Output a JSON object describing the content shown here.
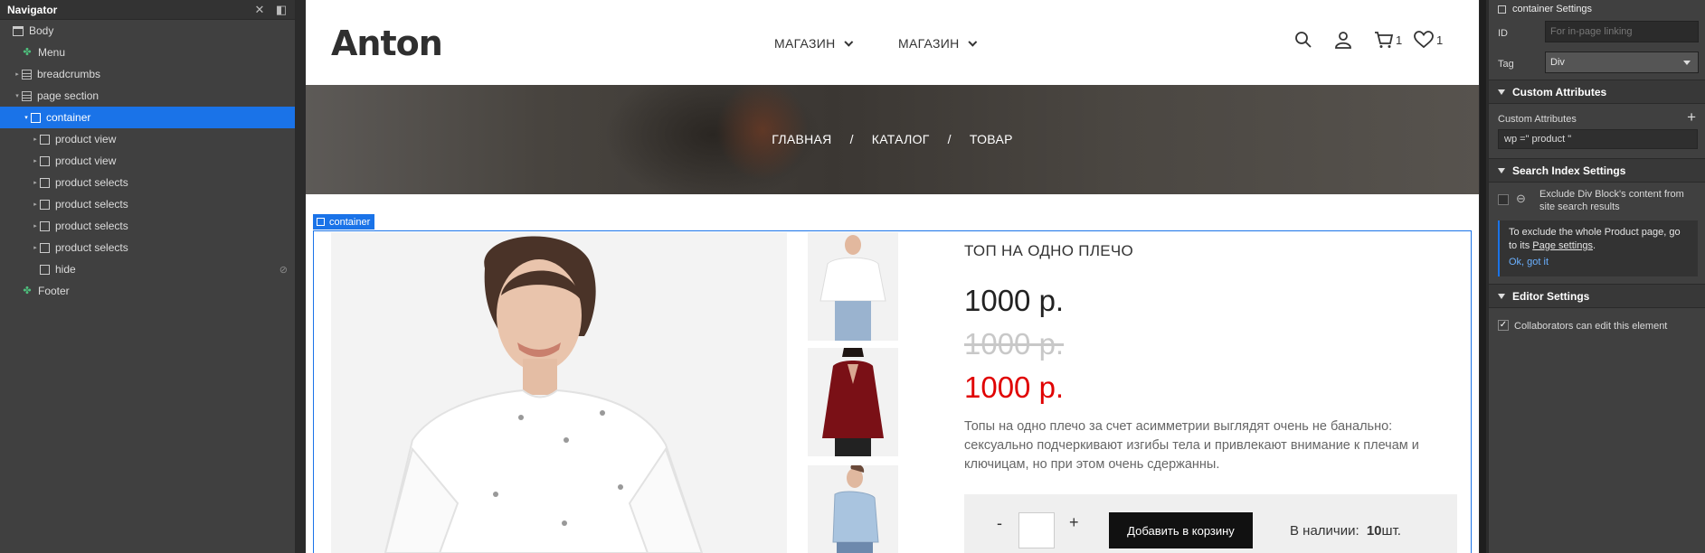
{
  "navigator": {
    "title": "Navigator",
    "items": [
      {
        "label": "Body",
        "depth": 0,
        "icon": "body-icon",
        "caret": "",
        "selected": false
      },
      {
        "label": "Menu",
        "depth": 1,
        "icon": "symbol-icon",
        "caret": "",
        "selected": false
      },
      {
        "label": "breadcrumbs",
        "depth": 1,
        "icon": "section-icon",
        "caret": "▸",
        "selected": false
      },
      {
        "label": "page section",
        "depth": 1,
        "icon": "section-icon",
        "caret": "▾",
        "selected": false
      },
      {
        "label": "container",
        "depth": 2,
        "icon": "div-icon",
        "caret": "▾",
        "selected": true
      },
      {
        "label": "product view",
        "depth": 3,
        "icon": "div-icon",
        "caret": "▸",
        "selected": false
      },
      {
        "label": "product view",
        "depth": 3,
        "icon": "div-icon",
        "caret": "▸",
        "selected": false
      },
      {
        "label": "product selects",
        "depth": 3,
        "icon": "div-icon",
        "caret": "▸",
        "selected": false
      },
      {
        "label": "product selects",
        "depth": 3,
        "icon": "div-icon",
        "caret": "▸",
        "selected": false
      },
      {
        "label": "product selects",
        "depth": 3,
        "icon": "div-icon",
        "caret": "▸",
        "selected": false
      },
      {
        "label": "product selects",
        "depth": 3,
        "icon": "div-icon",
        "caret": "▸",
        "selected": false
      },
      {
        "label": "hide",
        "depth": 3,
        "icon": "div-icon",
        "caret": "",
        "selected": false,
        "hidden": true
      },
      {
        "label": "Footer",
        "depth": 1,
        "icon": "symbol-icon",
        "caret": "",
        "selected": false
      }
    ]
  },
  "site": {
    "logo": "Anton",
    "menu": [
      {
        "label": "МАГАЗИН"
      },
      {
        "label": "МАГАЗИН"
      }
    ],
    "cart_count": "1",
    "wishlist_count": "1",
    "breadcrumbs": [
      "ГЛАВНАЯ",
      "/",
      "КАТАЛОГ",
      "/",
      "ТОВАР"
    ],
    "selection_label": "container",
    "product": {
      "title": "ТОП НА ОДНО ПЛЕЧО",
      "price": "1000 р.",
      "old_price": "1000 р.",
      "sale_price": "1000 р.",
      "description": "Топы на одно плечо за счет асимметрии выглядят очень не банально: сексуально подчеркивают изгибы тела и привлекают внимание к плечам и ключицам, но при этом очень сдержанны.",
      "qty_minus": "-",
      "qty_plus": "+",
      "add_to_cart": "Добавить в корзину",
      "stock_label": "В наличии:",
      "stock_count": "10",
      "stock_unit": "шт."
    },
    "colors": {
      "sale": "#e00000",
      "old": "#c8c8c8",
      "accent": "#1a73e8"
    }
  },
  "settings": {
    "header": "container Settings",
    "id_label": "ID",
    "id_placeholder": "For in-page linking",
    "tag_label": "Tag",
    "tag_value": "Div",
    "custom_attributes_section": "Custom Attributes",
    "custom_attributes_label": "Custom Attributes",
    "custom_attribute_value": "wp =\" product \"",
    "search_index_section": "Search Index Settings",
    "exclude_text": "Exclude Div Block's content from site search results",
    "info_text_1": "To exclude the whole Product page, go to its",
    "info_link": "Page settings",
    "info_text_2": ".",
    "info_ok": "Ok, got it",
    "editor_section": "Editor Settings",
    "collab_text": "Collaborators can edit this element"
  }
}
